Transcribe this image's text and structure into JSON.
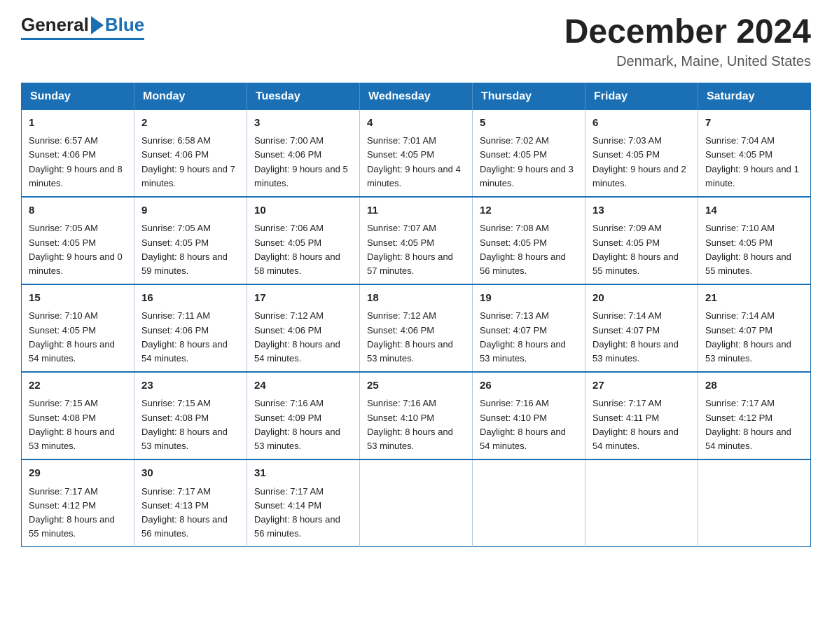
{
  "header": {
    "logo_general": "General",
    "logo_blue": "Blue",
    "month_title": "December 2024",
    "location": "Denmark, Maine, United States"
  },
  "weekdays": [
    "Sunday",
    "Monday",
    "Tuesday",
    "Wednesday",
    "Thursday",
    "Friday",
    "Saturday"
  ],
  "weeks": [
    [
      {
        "day": "1",
        "sunrise": "6:57 AM",
        "sunset": "4:06 PM",
        "daylight": "9 hours and 8 minutes."
      },
      {
        "day": "2",
        "sunrise": "6:58 AM",
        "sunset": "4:06 PM",
        "daylight": "9 hours and 7 minutes."
      },
      {
        "day": "3",
        "sunrise": "7:00 AM",
        "sunset": "4:06 PM",
        "daylight": "9 hours and 5 minutes."
      },
      {
        "day": "4",
        "sunrise": "7:01 AM",
        "sunset": "4:05 PM",
        "daylight": "9 hours and 4 minutes."
      },
      {
        "day": "5",
        "sunrise": "7:02 AM",
        "sunset": "4:05 PM",
        "daylight": "9 hours and 3 minutes."
      },
      {
        "day": "6",
        "sunrise": "7:03 AM",
        "sunset": "4:05 PM",
        "daylight": "9 hours and 2 minutes."
      },
      {
        "day": "7",
        "sunrise": "7:04 AM",
        "sunset": "4:05 PM",
        "daylight": "9 hours and 1 minute."
      }
    ],
    [
      {
        "day": "8",
        "sunrise": "7:05 AM",
        "sunset": "4:05 PM",
        "daylight": "9 hours and 0 minutes."
      },
      {
        "day": "9",
        "sunrise": "7:05 AM",
        "sunset": "4:05 PM",
        "daylight": "8 hours and 59 minutes."
      },
      {
        "day": "10",
        "sunrise": "7:06 AM",
        "sunset": "4:05 PM",
        "daylight": "8 hours and 58 minutes."
      },
      {
        "day": "11",
        "sunrise": "7:07 AM",
        "sunset": "4:05 PM",
        "daylight": "8 hours and 57 minutes."
      },
      {
        "day": "12",
        "sunrise": "7:08 AM",
        "sunset": "4:05 PM",
        "daylight": "8 hours and 56 minutes."
      },
      {
        "day": "13",
        "sunrise": "7:09 AM",
        "sunset": "4:05 PM",
        "daylight": "8 hours and 55 minutes."
      },
      {
        "day": "14",
        "sunrise": "7:10 AM",
        "sunset": "4:05 PM",
        "daylight": "8 hours and 55 minutes."
      }
    ],
    [
      {
        "day": "15",
        "sunrise": "7:10 AM",
        "sunset": "4:05 PM",
        "daylight": "8 hours and 54 minutes."
      },
      {
        "day": "16",
        "sunrise": "7:11 AM",
        "sunset": "4:06 PM",
        "daylight": "8 hours and 54 minutes."
      },
      {
        "day": "17",
        "sunrise": "7:12 AM",
        "sunset": "4:06 PM",
        "daylight": "8 hours and 54 minutes."
      },
      {
        "day": "18",
        "sunrise": "7:12 AM",
        "sunset": "4:06 PM",
        "daylight": "8 hours and 53 minutes."
      },
      {
        "day": "19",
        "sunrise": "7:13 AM",
        "sunset": "4:07 PM",
        "daylight": "8 hours and 53 minutes."
      },
      {
        "day": "20",
        "sunrise": "7:14 AM",
        "sunset": "4:07 PM",
        "daylight": "8 hours and 53 minutes."
      },
      {
        "day": "21",
        "sunrise": "7:14 AM",
        "sunset": "4:07 PM",
        "daylight": "8 hours and 53 minutes."
      }
    ],
    [
      {
        "day": "22",
        "sunrise": "7:15 AM",
        "sunset": "4:08 PM",
        "daylight": "8 hours and 53 minutes."
      },
      {
        "day": "23",
        "sunrise": "7:15 AM",
        "sunset": "4:08 PM",
        "daylight": "8 hours and 53 minutes."
      },
      {
        "day": "24",
        "sunrise": "7:16 AM",
        "sunset": "4:09 PM",
        "daylight": "8 hours and 53 minutes."
      },
      {
        "day": "25",
        "sunrise": "7:16 AM",
        "sunset": "4:10 PM",
        "daylight": "8 hours and 53 minutes."
      },
      {
        "day": "26",
        "sunrise": "7:16 AM",
        "sunset": "4:10 PM",
        "daylight": "8 hours and 54 minutes."
      },
      {
        "day": "27",
        "sunrise": "7:17 AM",
        "sunset": "4:11 PM",
        "daylight": "8 hours and 54 minutes."
      },
      {
        "day": "28",
        "sunrise": "7:17 AM",
        "sunset": "4:12 PM",
        "daylight": "8 hours and 54 minutes."
      }
    ],
    [
      {
        "day": "29",
        "sunrise": "7:17 AM",
        "sunset": "4:12 PM",
        "daylight": "8 hours and 55 minutes."
      },
      {
        "day": "30",
        "sunrise": "7:17 AM",
        "sunset": "4:13 PM",
        "daylight": "8 hours and 56 minutes."
      },
      {
        "day": "31",
        "sunrise": "7:17 AM",
        "sunset": "4:14 PM",
        "daylight": "8 hours and 56 minutes."
      },
      null,
      null,
      null,
      null
    ]
  ],
  "labels": {
    "sunrise": "Sunrise:",
    "sunset": "Sunset:",
    "daylight": "Daylight:"
  },
  "colors": {
    "header_bg": "#1a6fb5",
    "border": "#1a6fb5"
  }
}
